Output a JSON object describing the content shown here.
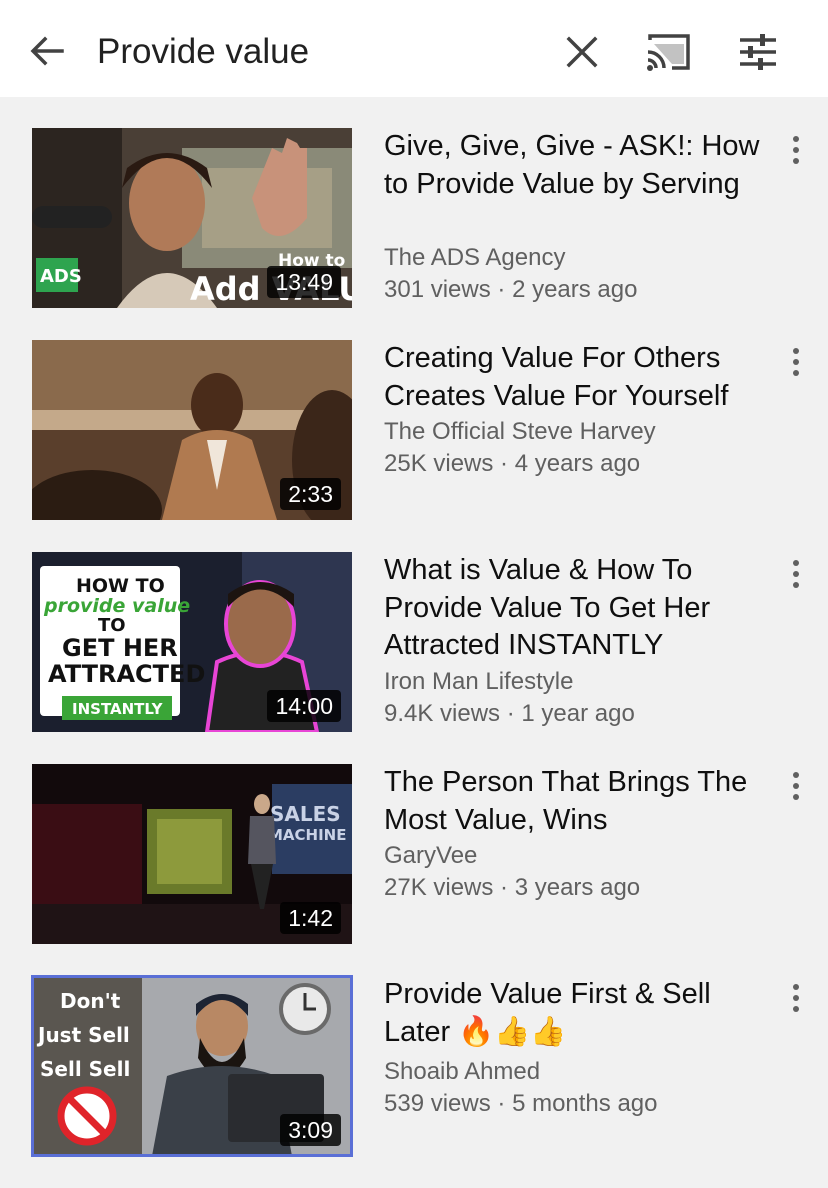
{
  "search": {
    "query": "Provide value"
  },
  "icons": {
    "back": "arrow-back-icon",
    "clear": "close-icon",
    "cast": "cast-icon",
    "filter": "filter-sliders-icon",
    "more": "more-vert-icon"
  },
  "results": [
    {
      "title": "Give, Give, Give - ASK!: How to Provide Value by Serving",
      "channel": "The ADS Agency",
      "views": "301 views",
      "age": "2 years ago",
      "duration": "13:49",
      "thumb_text": [
        "ADS",
        "How to",
        "Add VALUE"
      ]
    },
    {
      "title": "Creating Value For Others Creates Value For Yourself",
      "channel": "The Official Steve Harvey",
      "views": "25K views",
      "age": "4 years ago",
      "duration": "2:33"
    },
    {
      "title": "What is Value & How To Provide Value To Get Her Attracted INSTANTLY",
      "channel": "Iron Man Lifestyle",
      "views": "9.4K views",
      "age": "1 year ago",
      "duration": "14:00",
      "thumb_text": [
        "HOW TO",
        "provide value",
        "TO",
        "GET HER",
        "ATTRACTED",
        "INSTANTLY"
      ]
    },
    {
      "title": "The Person That Brings The Most Value, Wins",
      "channel": "GaryVee",
      "views": "27K views",
      "age": "3 years ago",
      "duration": "1:42",
      "thumb_text": [
        "SALES",
        "MACHINE"
      ]
    },
    {
      "title": "Provide Value First & Sell Later 🔥👍👍",
      "channel": "Shoaib Ahmed",
      "views": "539 views",
      "age": "5 months ago",
      "duration": "3:09",
      "thumb_text": [
        "Don't",
        "Just Sell",
        "Sell Sell"
      ]
    }
  ],
  "meta_separator": " · ",
  "colors": {
    "topbar": "#ffffff",
    "background": "#f1f1f1",
    "secondary_text": "#606060",
    "selected_outline": "#5a6fd6"
  }
}
